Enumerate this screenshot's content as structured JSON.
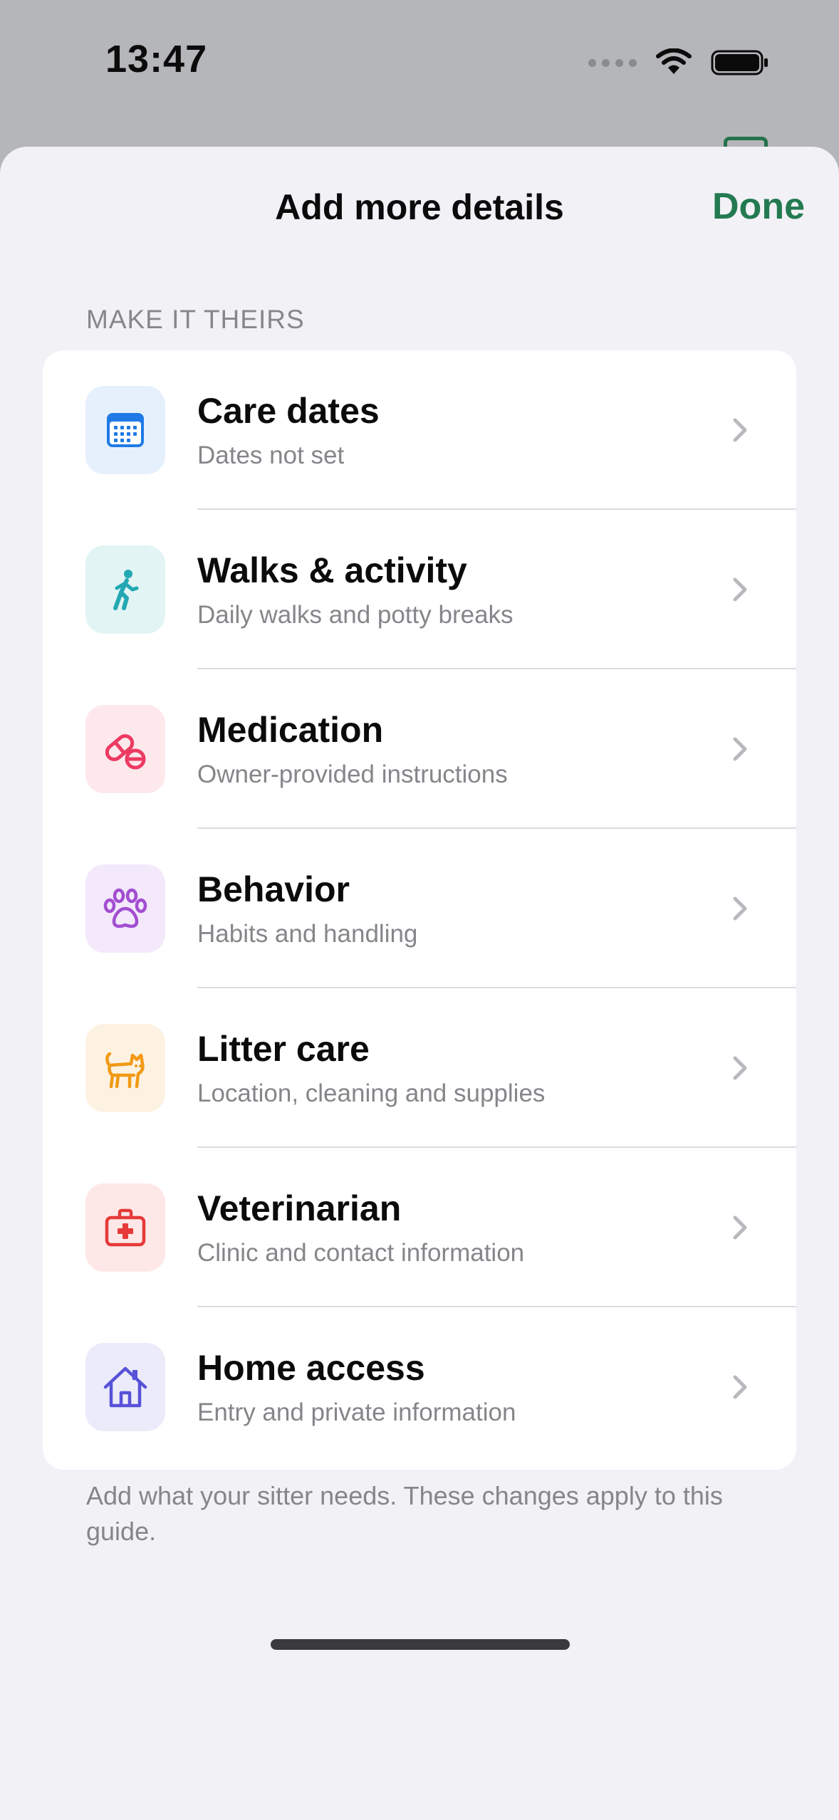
{
  "status_bar": {
    "time": "13:47"
  },
  "sheet": {
    "title": "Add more details",
    "done_label": "Done",
    "section_header": "MAKE IT THEIRS",
    "footer_note": "Add what your sitter needs. These changes apply to this guide."
  },
  "items": [
    {
      "title": "Care dates",
      "subtitle": "Dates not set",
      "icon": "calendar-icon",
      "icon_color": "#1f7ae6",
      "icon_bg": "#e6f0fc"
    },
    {
      "title": "Walks & activity",
      "subtitle": "Daily walks and potty breaks",
      "icon": "walking-person-icon",
      "icon_color": "#23a8b3",
      "icon_bg": "#e2f4f4"
    },
    {
      "title": "Medication",
      "subtitle": "Owner-provided instructions",
      "icon": "pills-icon",
      "icon_color": "#ec3a62",
      "icon_bg": "#fde8ec"
    },
    {
      "title": "Behavior",
      "subtitle": "Habits and handling",
      "icon": "paw-icon",
      "icon_color": "#a24ed1",
      "icon_bg": "#f3e9fb"
    },
    {
      "title": "Litter care",
      "subtitle": "Location, cleaning and supplies",
      "icon": "cat-icon",
      "icon_color": "#f19a15",
      "icon_bg": "#fdf2e2"
    },
    {
      "title": "Veterinarian",
      "subtitle": "Clinic and contact information",
      "icon": "medical-bag-icon",
      "icon_color": "#e63a3a",
      "icon_bg": "#fde8e7"
    },
    {
      "title": "Home access",
      "subtitle": "Entry and private information",
      "icon": "house-icon",
      "icon_color": "#5752d8",
      "icon_bg": "#ecebfa"
    }
  ]
}
